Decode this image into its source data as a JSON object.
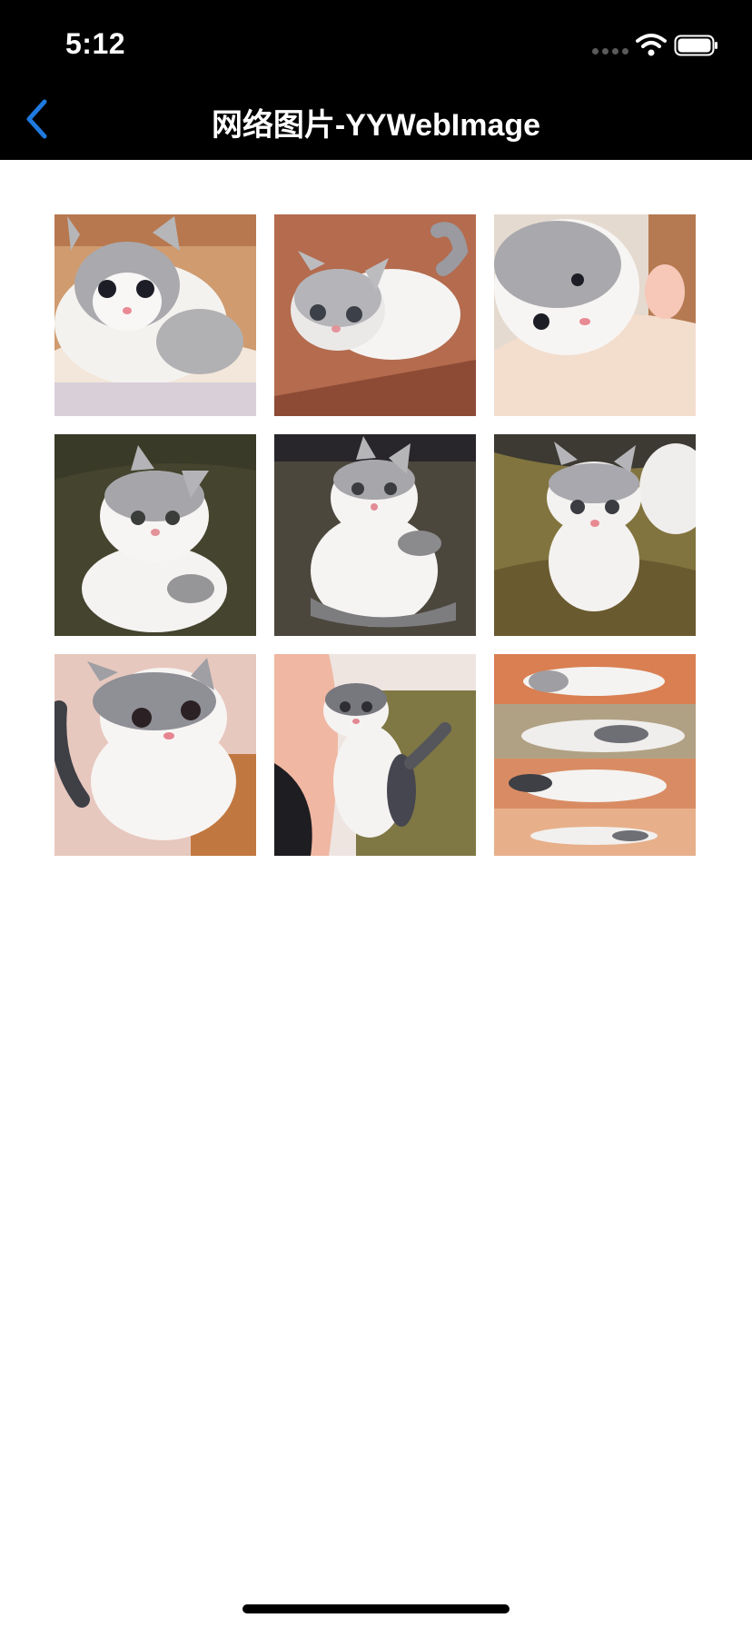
{
  "status_bar": {
    "time": "5:12",
    "icons": [
      "cellular-signal-icon",
      "wifi-icon",
      "battery-icon"
    ]
  },
  "nav_bar": {
    "back_icon": "chevron-left-icon",
    "title": "网络图片-YYWebImage",
    "accent_color": "#1f7ae0"
  },
  "gallery": {
    "items": [
      {
        "subject": "kitten lying with paws forward",
        "bg": "#cf9b6f"
      },
      {
        "subject": "kitten on wooden floor",
        "bg": "#b46b4e"
      },
      {
        "subject": "kitten held in hand",
        "bg": "#d8c7b6"
      },
      {
        "subject": "kitten sitting on dark sofa",
        "bg": "#44442f"
      },
      {
        "subject": "kitten sitting on dark sofa",
        "bg": "#4c473d"
      },
      {
        "subject": "kitten sitting on green cushion",
        "bg": "#82743f"
      },
      {
        "subject": "kitten close-up",
        "bg": "#e7c8be"
      },
      {
        "subject": "kitten sitting beside person",
        "bg": "#7f7744"
      },
      {
        "subject": "blurred animated kitten frames",
        "bg": "#cf6d3d"
      }
    ]
  }
}
